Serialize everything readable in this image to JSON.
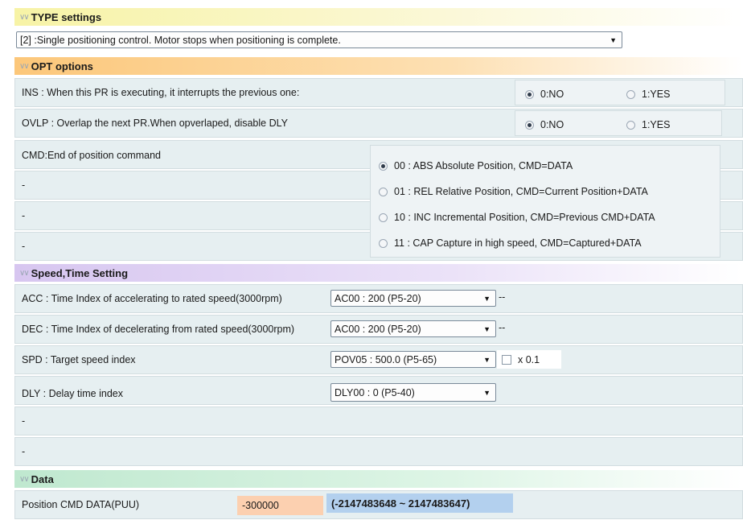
{
  "sections": {
    "type": {
      "title": "TYPE settings"
    },
    "opt": {
      "title": "OPT options"
    },
    "speed": {
      "title": "Speed,Time Setting"
    },
    "data": {
      "title": "Data"
    }
  },
  "type_select": {
    "value": "[2] :Single positioning control.  Motor stops when positioning is complete."
  },
  "opt": {
    "ins": {
      "label": "INS : When this PR is executing, it interrupts the previous one:",
      "opt0": "0:NO",
      "opt1": "1:YES",
      "selected": "0:NO"
    },
    "ovlp": {
      "label": "OVLP : Overlap the next PR.When opverlaped, disable DLY",
      "opt0": "0:NO",
      "opt1": "1:YES",
      "selected": "0:NO"
    },
    "cmd": {
      "label": "CMD:End of position command",
      "options": [
        "00 : ABS Absolute Position, CMD=DATA",
        "01 : REL Relative Position, CMD=Current Position+DATA",
        "10 : INC Incremental Position, CMD=Previous CMD+DATA",
        "11 : CAP Capture in high speed, CMD=Captured+DATA"
      ],
      "selected_index": 0
    },
    "blank_rows": [
      "-",
      "-",
      "-"
    ]
  },
  "speed": {
    "acc": {
      "label": "ACC : Time Index of accelerating to rated speed(3000rpm)",
      "value": "AC00 : 200 (P5-20)",
      "suffix": "--"
    },
    "dec": {
      "label": "DEC : Time Index of decelerating from rated speed(3000rpm)",
      "value": "AC00 : 200 (P5-20)",
      "suffix": "--"
    },
    "spd": {
      "label": "SPD : Target speed index",
      "value": "POV05 : 500.0 (P5-65)",
      "checkbox_label": "x 0.1"
    },
    "dly": {
      "label": "DLY : Delay time index",
      "value": "DLY00 : 0 (P5-40)"
    },
    "blank_rows": [
      "-",
      "-"
    ]
  },
  "data": {
    "label": "Position CMD DATA(PUU)",
    "value": "-300000",
    "range": "(-2147483648 ~ 2147483647)"
  }
}
